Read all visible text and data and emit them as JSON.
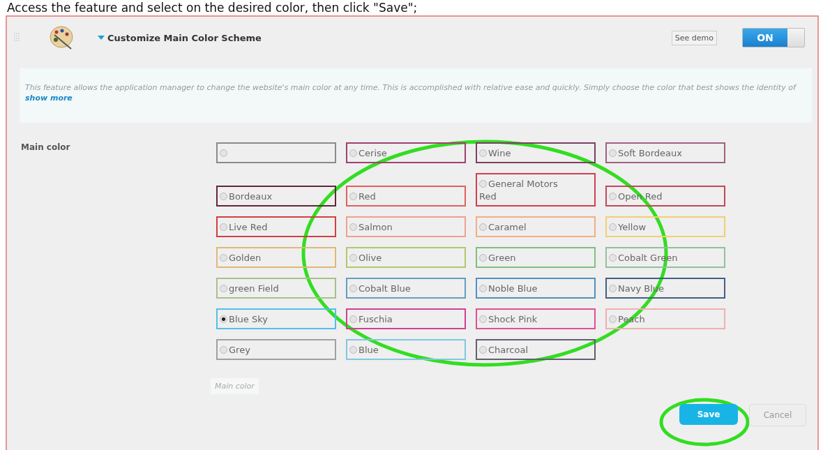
{
  "caption": "Access the feature and select on the desired color, then click \"Save\";",
  "header": {
    "title": "Customize Main Color Scheme",
    "expanded": true,
    "demo_button": "See demo",
    "toggle": {
      "label": "ON",
      "on": true
    }
  },
  "description": {
    "text": "This feature allows the application manager to change the website's main color at any time. This is accomplished with relative ease and quickly. Simply choose the color that best shows the identity of",
    "link": "show more"
  },
  "field_label": "Main color",
  "options": [
    {
      "color": "#8a8a8a",
      "selected": false
    },
    {
      "label": "Cerise",
      "color": "#a04070",
      "selected": false
    },
    {
      "label": "Wine",
      "color": "#7a4060",
      "selected": false
    },
    {
      "label": "Soft Bordeaux",
      "color": "#a06080",
      "selected": false
    },
    {
      "label": "Bordeaux",
      "color": "#602838",
      "selected": false
    },
    {
      "label": "Red",
      "color": "#e06060",
      "selected": false
    },
    {
      "label": "General Motors Red",
      "color": "#d04050",
      "selected": false
    },
    {
      "label": "Open Red",
      "color": "#c04858",
      "selected": false
    },
    {
      "label": "Live Red",
      "color": "#d04040",
      "selected": false
    },
    {
      "label": "Salmon",
      "color": "#f0a090",
      "selected": false
    },
    {
      "label": "Caramel",
      "color": "#f0b080",
      "selected": false
    },
    {
      "label": "Yellow",
      "color": "#f0d070",
      "selected": false
    },
    {
      "label": "Golden",
      "color": "#e0b878",
      "selected": false
    },
    {
      "label": "Olive",
      "color": "#b0c870",
      "selected": false
    },
    {
      "label": "Green",
      "color": "#80c080",
      "selected": false
    },
    {
      "label": "Cobalt Green",
      "color": "#90c0a0",
      "selected": false
    },
    {
      "label": "green Field",
      "color": "#a8c088",
      "selected": false
    },
    {
      "label": "Cobalt Blue",
      "color": "#60a0c0",
      "selected": false
    },
    {
      "label": "Noble Blue",
      "color": "#5090c0",
      "selected": false
    },
    {
      "label": "Navy Blue",
      "color": "#406080",
      "selected": false
    },
    {
      "label": "Blue Sky",
      "color": "#50c0e8",
      "selected": true
    },
    {
      "label": "Fuschia",
      "color": "#d04090",
      "selected": false
    },
    {
      "label": "Shock Pink",
      "color": "#e05090",
      "selected": false
    },
    {
      "label": "Peach",
      "color": "#f0b0b0",
      "selected": false
    },
    {
      "label": "Grey",
      "color": "#a0a0a0",
      "selected": false
    },
    {
      "label": "Blue",
      "color": "#80c8e0",
      "selected": false
    },
    {
      "label": "Charcoal",
      "color": "#606070",
      "selected": false
    }
  ],
  "hint": "Main color",
  "buttons": {
    "save": "Save",
    "cancel": "Cancel"
  }
}
